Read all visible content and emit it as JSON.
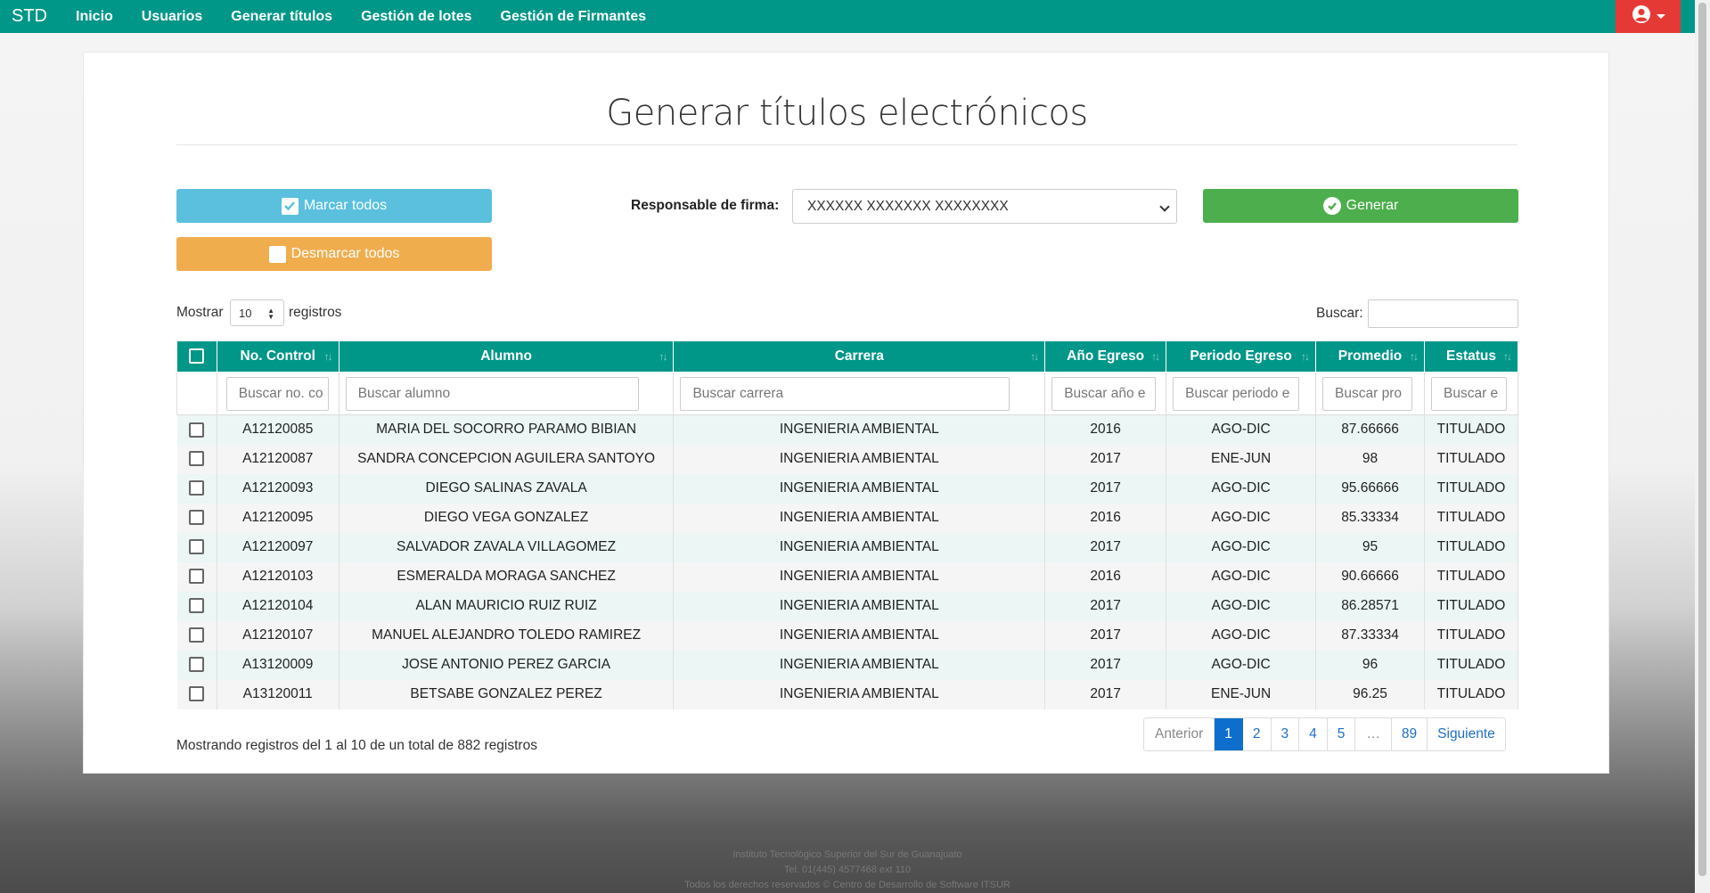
{
  "navbar": {
    "brand": "STD",
    "links": [
      "Inicio",
      "Usuarios",
      "Generar títulos",
      "Gestión de lotes",
      "Gestión de Firmantes"
    ]
  },
  "page": {
    "title": "Generar títulos electrónicos"
  },
  "actions": {
    "mark_all": "Marcar todos",
    "unmark_all": "Desmarcar todos",
    "generate": "Generar",
    "firma_label": "Responsable de firma:",
    "firma_value": "XXXXXX XXXXXXX XXXXXXXX"
  },
  "table_controls": {
    "show_label": "Mostrar",
    "show_value": "10",
    "records_label": "registros",
    "search_label": "Buscar:"
  },
  "table": {
    "headers": [
      "No. Control",
      "Alumno",
      "Carrera",
      "Año Egreso",
      "Periodo Egreso",
      "Promedio",
      "Estatus"
    ],
    "filters": [
      "Buscar no. co",
      "Buscar alumno",
      "Buscar carrera",
      "Buscar año e",
      "Buscar periodo e",
      "Buscar pro",
      "Buscar e"
    ],
    "rows": [
      {
        "control": "A12120085",
        "alumno": "MARIA DEL SOCORRO PARAMO BIBIAN",
        "carrera": "INGENIERIA AMBIENTAL",
        "anio": "2016",
        "periodo": "AGO-DIC",
        "promedio": "87.66666",
        "estatus": "TITULADO"
      },
      {
        "control": "A12120087",
        "alumno": "SANDRA CONCEPCION AGUILERA SANTOYO",
        "carrera": "INGENIERIA AMBIENTAL",
        "anio": "2017",
        "periodo": "ENE-JUN",
        "promedio": "98",
        "estatus": "TITULADO"
      },
      {
        "control": "A12120093",
        "alumno": "DIEGO SALINAS ZAVALA",
        "carrera": "INGENIERIA AMBIENTAL",
        "anio": "2017",
        "periodo": "AGO-DIC",
        "promedio": "95.66666",
        "estatus": "TITULADO"
      },
      {
        "control": "A12120095",
        "alumno": "DIEGO VEGA GONZALEZ",
        "carrera": "INGENIERIA AMBIENTAL",
        "anio": "2016",
        "periodo": "AGO-DIC",
        "promedio": "85.33334",
        "estatus": "TITULADO"
      },
      {
        "control": "A12120097",
        "alumno": "SALVADOR ZAVALA VILLAGOMEZ",
        "carrera": "INGENIERIA AMBIENTAL",
        "anio": "2017",
        "periodo": "AGO-DIC",
        "promedio": "95",
        "estatus": "TITULADO"
      },
      {
        "control": "A12120103",
        "alumno": "ESMERALDA MORAGA SANCHEZ",
        "carrera": "INGENIERIA AMBIENTAL",
        "anio": "2016",
        "periodo": "AGO-DIC",
        "promedio": "90.66666",
        "estatus": "TITULADO"
      },
      {
        "control": "A12120104",
        "alumno": "ALAN MAURICIO RUIZ RUIZ",
        "carrera": "INGENIERIA AMBIENTAL",
        "anio": "2017",
        "periodo": "AGO-DIC",
        "promedio": "86.28571",
        "estatus": "TITULADO"
      },
      {
        "control": "A12120107",
        "alumno": "MANUEL ALEJANDRO TOLEDO RAMIREZ",
        "carrera": "INGENIERIA AMBIENTAL",
        "anio": "2017",
        "periodo": "AGO-DIC",
        "promedio": "87.33334",
        "estatus": "TITULADO"
      },
      {
        "control": "A13120009",
        "alumno": "JOSE ANTONIO PEREZ GARCIA",
        "carrera": "INGENIERIA AMBIENTAL",
        "anio": "2017",
        "periodo": "AGO-DIC",
        "promedio": "96",
        "estatus": "TITULADO"
      },
      {
        "control": "A13120011",
        "alumno": "BETSABE GONZALEZ PEREZ",
        "carrera": "INGENIERIA AMBIENTAL",
        "anio": "2017",
        "periodo": "ENE-JUN",
        "promedio": "96.25",
        "estatus": "TITULADO"
      }
    ]
  },
  "pagination": {
    "info": "Mostrando registros del 1 al 10 de un total de 882 registros",
    "prev": "Anterior",
    "pages": [
      "1",
      "2",
      "3",
      "4",
      "5",
      "…",
      "89"
    ],
    "next": "Siguiente",
    "current": "1"
  },
  "footer": {
    "lines": [
      "Instituto Tecnológico Superior del Sur de Guanajuato",
      "Tel. 01(445) 4577468 ext 110",
      "Todos los derechos reservados © Centro de Desarrollo de Software ITSUR"
    ]
  },
  "colors": {
    "primary": "#009688",
    "info": "#5bc0de",
    "warning": "#f0ad4e",
    "success": "#4cae4c",
    "danger": "#e53935",
    "page_active": "#0d6ecd"
  },
  "icons": {
    "user": "user-circle-icon",
    "check_square": "check-square-icon",
    "empty_square": "square-icon",
    "check_circle": "check-circle-icon"
  }
}
